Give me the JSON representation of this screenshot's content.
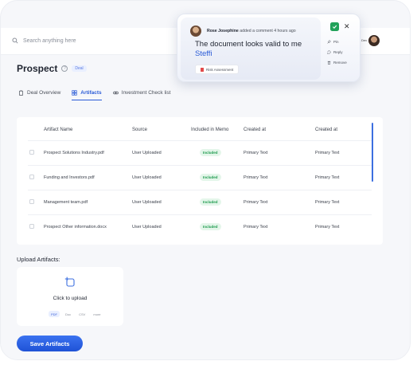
{
  "header": {
    "search_placeholder": "Search anything here",
    "user_label": "Dev"
  },
  "page": {
    "title": "Prospect",
    "badge": "Deal"
  },
  "tabs": [
    {
      "label": "Deal Overview",
      "icon": "clipboard-icon",
      "active": false
    },
    {
      "label": "Artifacts",
      "icon": "grid-icon",
      "active": true
    },
    {
      "label": "Investment Check list",
      "icon": "link-icon",
      "active": false
    }
  ],
  "table": {
    "columns": [
      "Artifact Name",
      "Source",
      "Included in Memo",
      "Created at",
      "Created at"
    ],
    "rows": [
      {
        "name": "Prospect Solutions Industry.pdf",
        "source": "User Uploaded",
        "status": "Included",
        "created1": "Primary Text",
        "created2": "Primary Text"
      },
      {
        "name": "Funding and Investors.pdf",
        "source": "User Uploaded",
        "status": "Included",
        "created1": "Primary Text",
        "created2": "Primary Text"
      },
      {
        "name": "Management team.pdf",
        "source": "User Uploaded",
        "status": "Included",
        "created1": "Primary Text",
        "created2": "Primary Text"
      },
      {
        "name": "Prospect Other information.docx",
        "source": "User Uploaded",
        "status": "Included",
        "created1": "Primary Text",
        "created2": "Primary Text"
      }
    ]
  },
  "upload": {
    "label": "Upload Artifacts:",
    "cta": "Click to upload",
    "formats": [
      "PDF",
      "Doc",
      "CSV",
      "more"
    ]
  },
  "save_button": "Save Artifacts",
  "comment": {
    "author": "Rose Josephine",
    "meta": "added a comment 4 hours ago",
    "message_prefix": "The document looks valid to me",
    "mention": "Steffi",
    "doc_name": "Risk Assessment",
    "actions": [
      "Pin",
      "Reply",
      "Remove"
    ]
  },
  "colors": {
    "accent": "#2a5bd7",
    "included_green": "#1d9a4d",
    "check_green": "#22a25a"
  }
}
